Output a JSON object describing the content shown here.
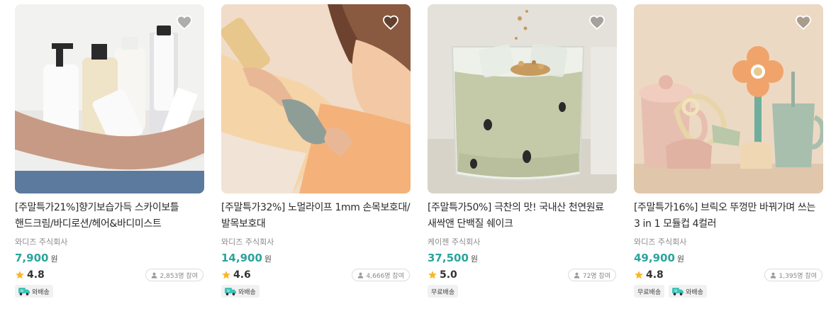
{
  "products": [
    {
      "title": "[주말특가21%]향기보습가득 스카이보틀 핸드크림/바디로션/헤어&바디미스트",
      "seller": "와디즈 주식회사",
      "price": "7,900",
      "currency": "원",
      "rating": "4.8",
      "participants": "2,853명 참여",
      "tags": [
        {
          "label": "와배송",
          "icon": "truck-icon"
        }
      ]
    },
    {
      "title": "[주말특가32%] 노멀라이프 1mm 손목보호대/발목보호대",
      "seller": "와디즈 주식회사",
      "price": "14,900",
      "currency": "원",
      "rating": "4.6",
      "participants": "4,666명 참여",
      "tags": [
        {
          "label": "와배송",
          "icon": "truck-icon"
        }
      ]
    },
    {
      "title": "[주말특가50%] 극찬의 맛! 국내산 천연원료 새싹앤 단백질 쉐이크",
      "seller": "케이젠 주식회사",
      "price": "37,500",
      "currency": "원",
      "rating": "5.0",
      "participants": "72명 참여",
      "tags": [
        {
          "label": "무료배송",
          "icon": ""
        }
      ]
    },
    {
      "title": "[주말특가16%] 브릭오 뚜껑만 바꿔가며 쓰는 3 in 1 모듈컵 4컬러",
      "seller": "와디즈 주식회사",
      "price": "49,900",
      "currency": "원",
      "rating": "4.8",
      "participants": "1,395명 참여",
      "tags": [
        {
          "label": "무료배송",
          "icon": ""
        },
        {
          "label": "와배송",
          "icon": "truck-icon"
        }
      ]
    }
  ],
  "colors": {
    "price": "#2aa59c",
    "star": "#f5b82e",
    "truck": "#3ec3b9"
  }
}
